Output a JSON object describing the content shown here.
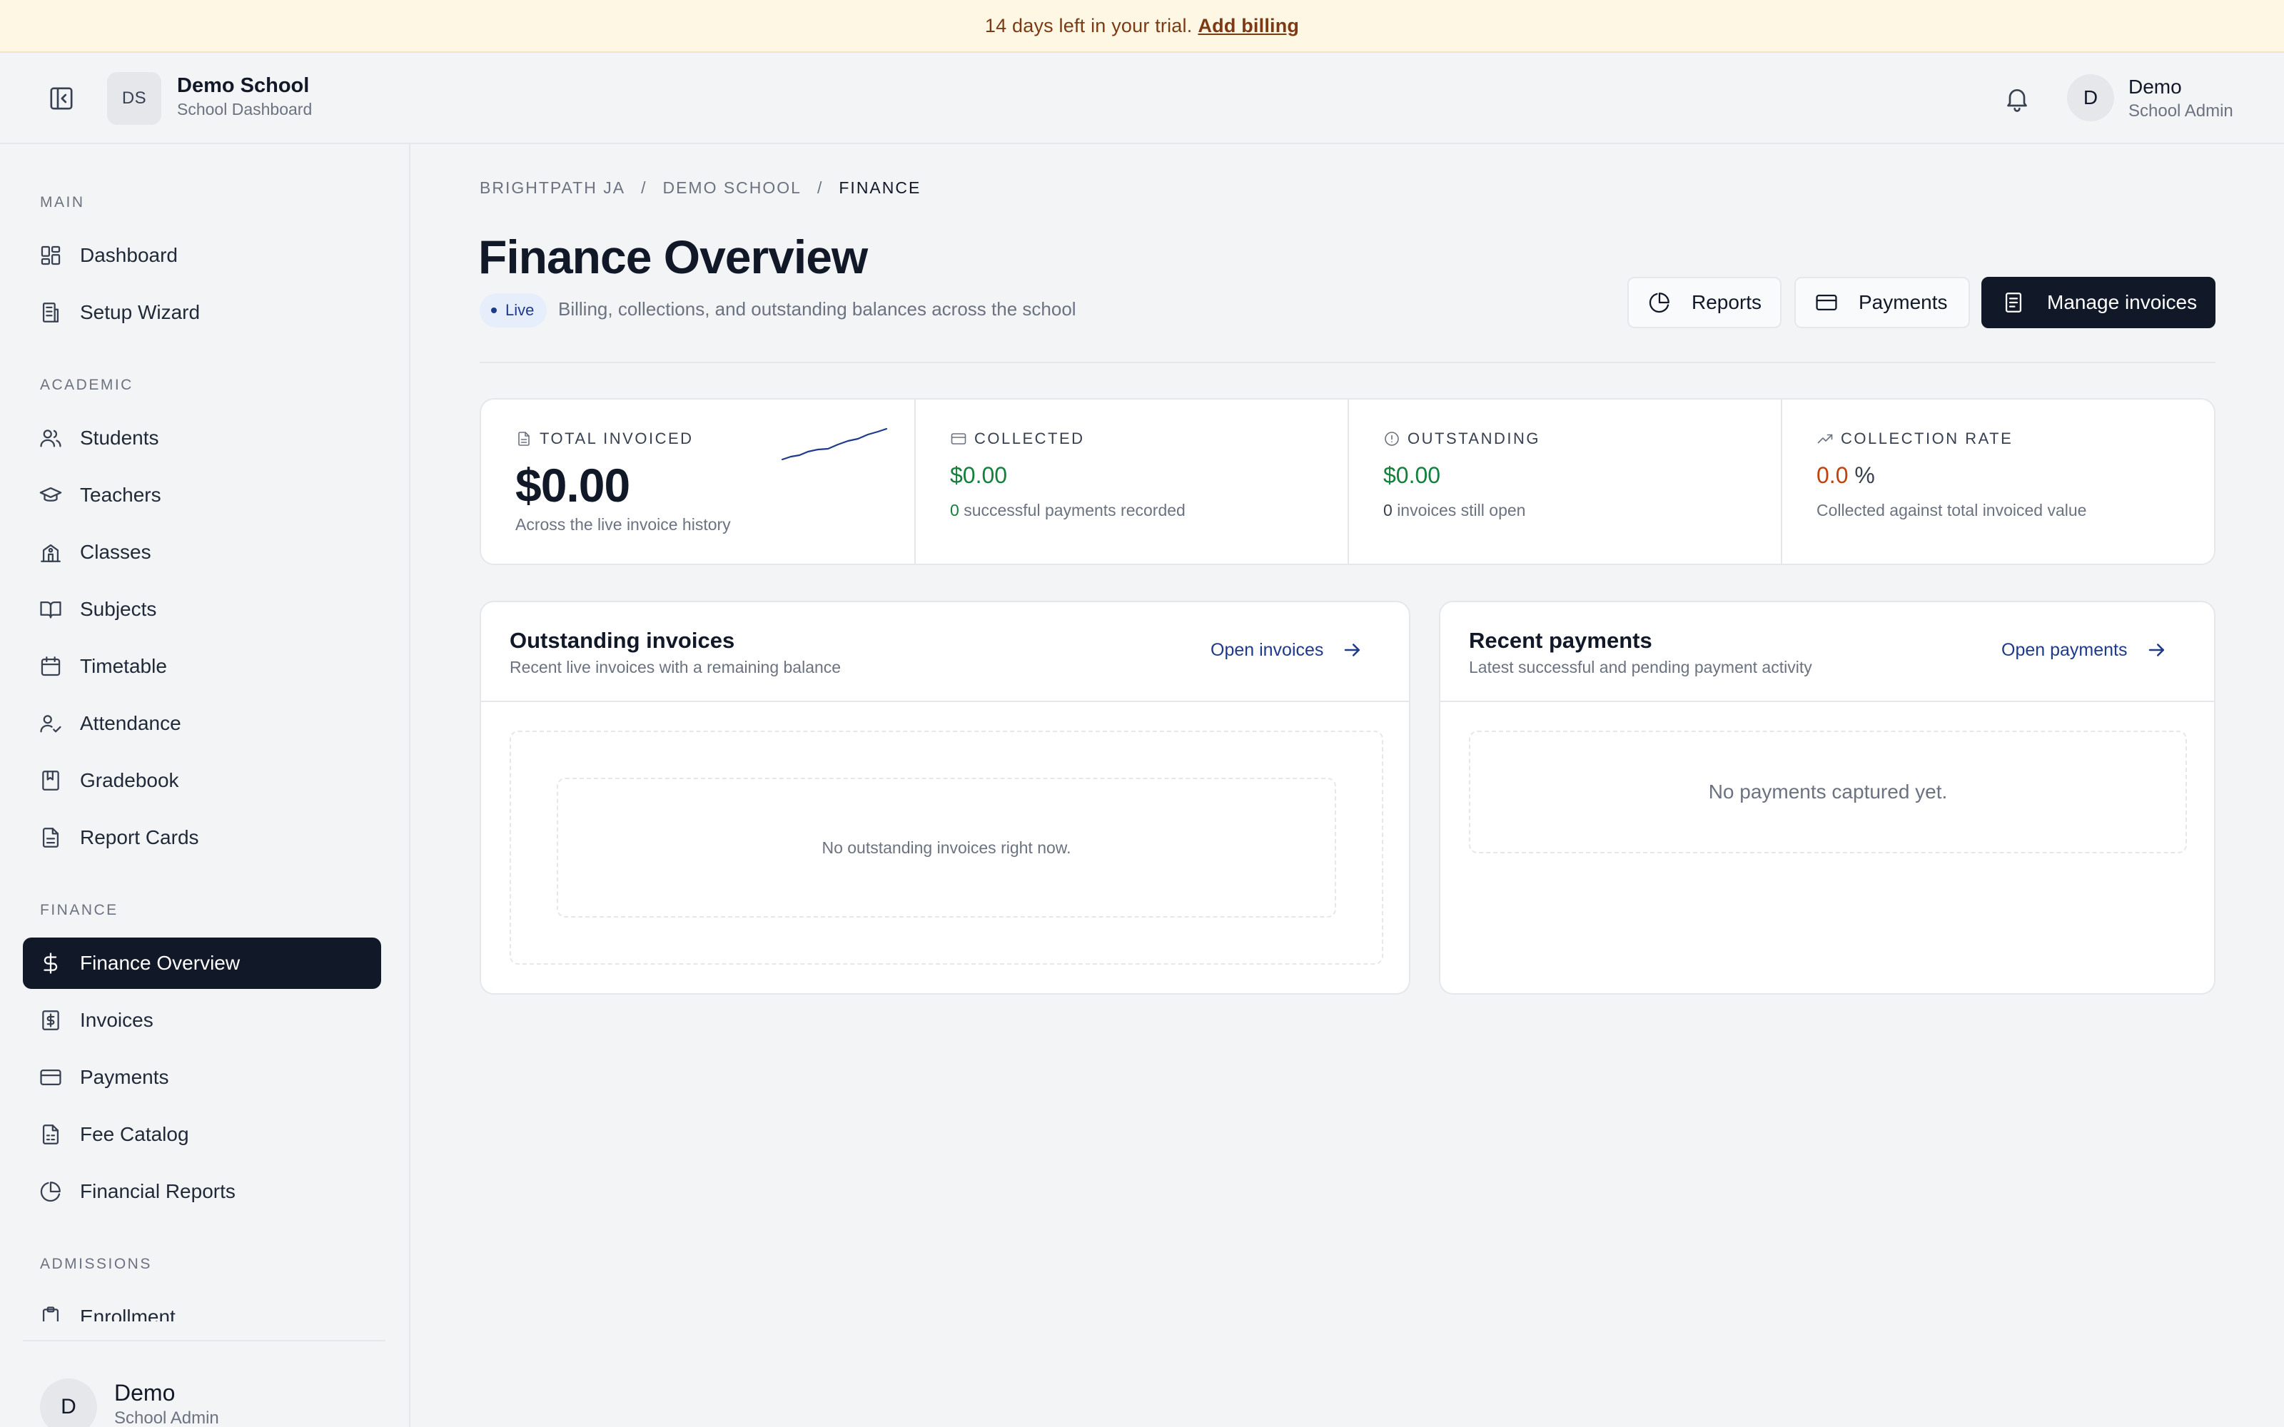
{
  "trial_banner": {
    "message": "14 days left in your trial.",
    "link": "Add billing"
  },
  "header": {
    "school_initials": "DS",
    "school_name": "Demo School",
    "school_subtitle": "School Dashboard",
    "user_initial": "D",
    "user_name": "Demo",
    "user_role": "School Admin"
  },
  "sidebar": {
    "sections": [
      {
        "label": "Main",
        "items": [
          {
            "label": "Dashboard",
            "icon": "dashboard-icon"
          },
          {
            "label": "Setup Wizard",
            "icon": "building-icon"
          }
        ]
      },
      {
        "label": "Academic",
        "items": [
          {
            "label": "Students",
            "icon": "users-icon"
          },
          {
            "label": "Teachers",
            "icon": "graduation-cap-icon"
          },
          {
            "label": "Classes",
            "icon": "school-icon"
          },
          {
            "label": "Subjects",
            "icon": "book-open-icon"
          },
          {
            "label": "Timetable",
            "icon": "calendar-icon"
          },
          {
            "label": "Attendance",
            "icon": "user-check-icon"
          },
          {
            "label": "Gradebook",
            "icon": "notebook-icon"
          },
          {
            "label": "Report Cards",
            "icon": "file-text-icon"
          }
        ]
      },
      {
        "label": "Finance",
        "items": [
          {
            "label": "Finance Overview",
            "icon": "dollar-icon",
            "active": true
          },
          {
            "label": "Invoices",
            "icon": "receipt-icon"
          },
          {
            "label": "Payments",
            "icon": "credit-card-icon"
          },
          {
            "label": "Fee Catalog",
            "icon": "file-spreadsheet-icon"
          },
          {
            "label": "Financial Reports",
            "icon": "pie-chart-icon"
          }
        ]
      },
      {
        "label": "Admissions",
        "items": [
          {
            "label": "Enrollment",
            "icon": "clipboard-icon"
          }
        ]
      }
    ],
    "footer": {
      "user_initial": "D",
      "user_name": "Demo",
      "user_role": "School Admin"
    }
  },
  "breadcrumb": [
    "BRIGHTPATH JA",
    "DEMO SCHOOL",
    "FINANCE"
  ],
  "page": {
    "title": "Finance Overview",
    "status_badge": "Live",
    "subtitle": "Billing, collections, and outstanding balances across the school"
  },
  "actions": {
    "reports": "Reports",
    "payments": "Payments",
    "manage_invoices": "Manage invoices"
  },
  "stats": {
    "total_invoiced": {
      "label": "TOTAL INVOICED",
      "value": "$0.00",
      "description": "Across the live invoice history"
    },
    "collected": {
      "label": "COLLECTED",
      "value": "$0.00",
      "count": "0",
      "count_text": "successful payments recorded"
    },
    "outstanding": {
      "label": "OUTSTANDING",
      "value": "$0.00",
      "count": "0",
      "count_text": "invoices still open"
    },
    "collection_rate": {
      "label": "COLLECTION RATE",
      "value": "0.0",
      "unit": "%",
      "description": "Collected against total invoiced value"
    }
  },
  "outstanding_card": {
    "title": "Outstanding invoices",
    "subtitle": "Recent live invoices with a remaining balance",
    "link": "Open invoices",
    "empty": "No outstanding invoices right now."
  },
  "payments_card": {
    "title": "Recent payments",
    "subtitle": "Latest successful and pending payment activity",
    "link": "Open payments",
    "empty": "No payments captured yet."
  },
  "colors": {
    "accent": "#111827",
    "positive": "#15803d",
    "warning": "#c2410c",
    "link": "#1e3a8a",
    "banner_bg": "#fdf7e3"
  }
}
